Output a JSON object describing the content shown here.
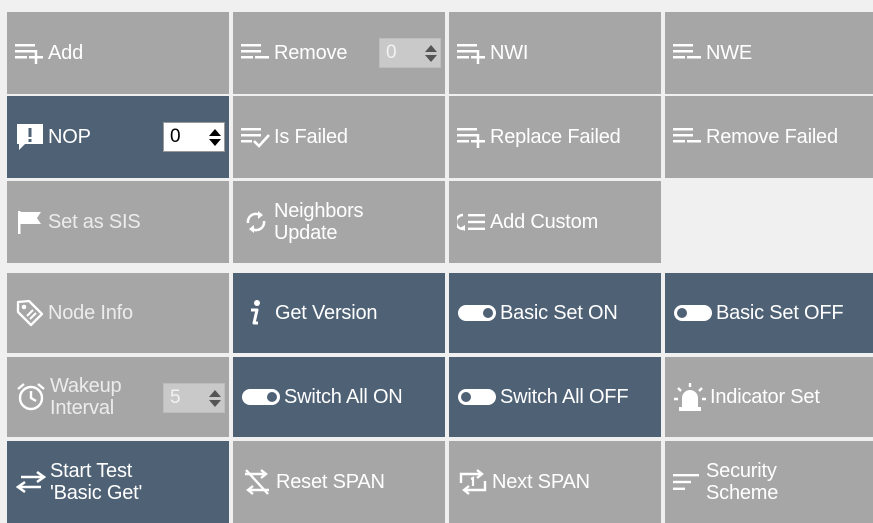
{
  "colors": {
    "tile_gray": "#a6a6a6",
    "tile_dark": "#4e6175",
    "background": "#f0f0f0",
    "text": "#ffffff"
  },
  "rows": {
    "r1": {
      "add": {
        "label": "Add",
        "icon": "add-list-icon"
      },
      "remove": {
        "label": "Remove",
        "icon": "remove-list-icon",
        "spin_value": "0"
      },
      "nwi": {
        "label": "NWI",
        "icon": "add-list-icon"
      },
      "nwe": {
        "label": "NWE",
        "icon": "remove-list-icon"
      }
    },
    "r2": {
      "nop": {
        "label": "NOP",
        "icon": "alert-message-icon",
        "spin_value": "0"
      },
      "is_failed": {
        "label": "Is Failed",
        "icon": "check-list-icon"
      },
      "replace_failed": {
        "label": "Replace Failed",
        "icon": "add-list-icon"
      },
      "remove_failed": {
        "label": "Remove Failed",
        "icon": "remove-list-icon"
      }
    },
    "r3": {
      "set_as_sis": {
        "label": "Set as SIS",
        "icon": "flag-icon"
      },
      "neighbors_update": {
        "line1": "Neighbors",
        "line2": "Update",
        "icon": "refresh-icon"
      },
      "add_custom": {
        "label": "Add Custom",
        "icon": "custom-list-icon"
      }
    },
    "r4": {
      "node_info": {
        "label": "Node Info",
        "icon": "tag-icon"
      },
      "get_version": {
        "label": "Get Version",
        "icon": "info-icon"
      },
      "basic_set_on": {
        "label": "Basic Set ON",
        "icon": "toggle-on-icon"
      },
      "basic_set_off": {
        "label": "Basic Set OFF",
        "icon": "toggle-off-icon"
      }
    },
    "r5": {
      "wakeup_interval": {
        "line1": "Wakeup",
        "line2": "Interval",
        "icon": "alarm-clock-icon",
        "spin_value": "5"
      },
      "switch_all_on": {
        "label": "Switch All ON",
        "icon": "toggle-on-icon"
      },
      "switch_all_off": {
        "label": "Switch All OFF",
        "icon": "toggle-off-icon"
      },
      "indicator_set": {
        "label": "Indicator Set",
        "icon": "siren-icon"
      }
    },
    "r6": {
      "start_test": {
        "line1": "Start Test",
        "line2": "'Basic Get'",
        "icon": "swap-arrows-icon"
      },
      "reset_span": {
        "label": "Reset SPAN",
        "icon": "reset-span-icon"
      },
      "next_span": {
        "label": "Next SPAN",
        "icon": "next-span-icon"
      },
      "security_scheme": {
        "line1": "Security",
        "line2": "Scheme",
        "icon": "lines-icon"
      }
    }
  }
}
